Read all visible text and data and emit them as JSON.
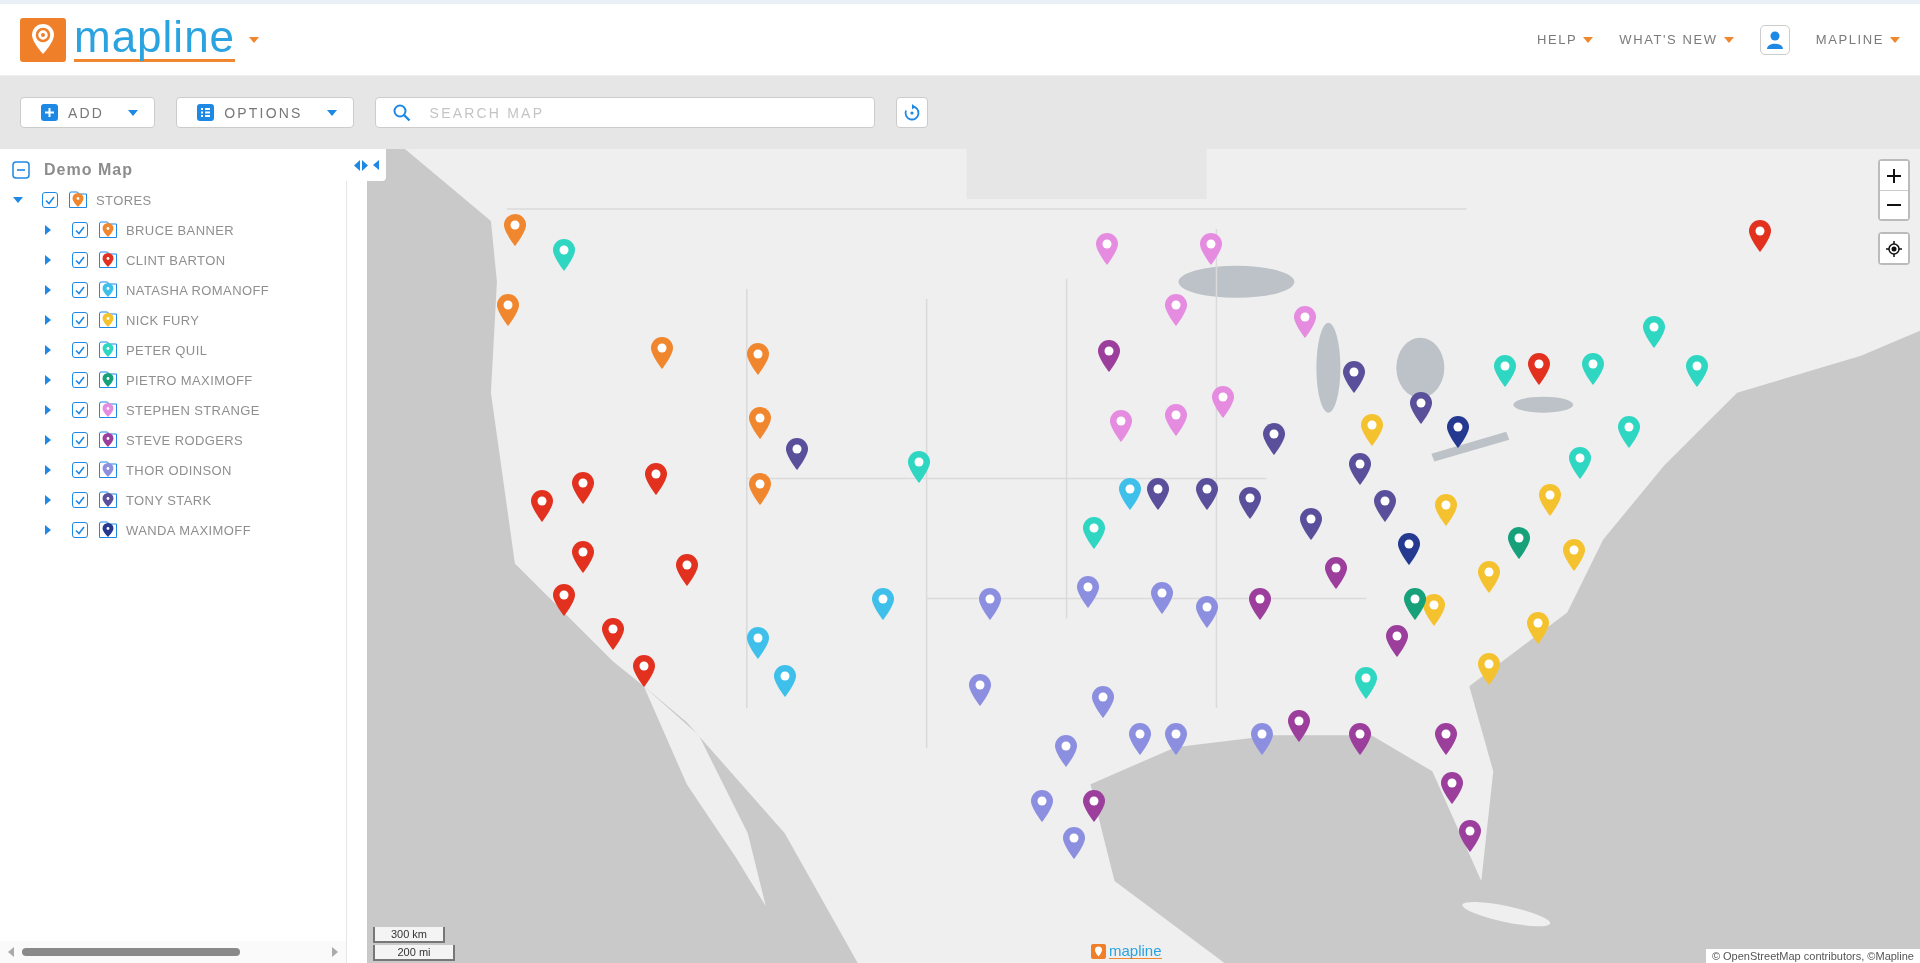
{
  "header": {
    "logo_text": "mapline",
    "menu": [
      {
        "label": "HELP",
        "kind": "menu"
      },
      {
        "label": "WHAT'S NEW",
        "kind": "menu"
      },
      {
        "label": "MAPLINE",
        "kind": "account"
      }
    ]
  },
  "toolbar": {
    "buttons": [
      {
        "label": "ADD",
        "kind": "add"
      },
      {
        "label": "OPTIONS",
        "kind": "options"
      }
    ],
    "search": {
      "placeholder": "SEARCH MAP"
    }
  },
  "sidebar": {
    "map": {
      "label": "Demo Map",
      "expanded": true
    },
    "layers": [
      {
        "label": "STORES",
        "expanded": true,
        "checked": true,
        "color": "#f0862e",
        "children": [
          {
            "label": "BRUCE BANNER",
            "expanded": false,
            "checked": true,
            "color": "#f0862e"
          },
          {
            "label": "CLINT BARTON",
            "expanded": false,
            "checked": true,
            "color": "#e2321f"
          },
          {
            "label": "NATASHA ROMANOFF",
            "expanded": false,
            "checked": true,
            "color": "#3fc0ea"
          },
          {
            "label": "NICK FURY",
            "expanded": false,
            "checked": true,
            "color": "#f5c22f"
          },
          {
            "label": "PETER QUIL",
            "expanded": false,
            "checked": true,
            "color": "#2fd6c2"
          },
          {
            "label": "PIETRO MAXIMOFF",
            "expanded": false,
            "checked": true,
            "color": "#17a17a"
          },
          {
            "label": "STEPHEN STRANGE",
            "expanded": false,
            "checked": true,
            "color": "#e58be0"
          },
          {
            "label": "STEVE RODGERS",
            "expanded": false,
            "checked": true,
            "color": "#9c3e9c"
          },
          {
            "label": "THOR ODINSON",
            "expanded": false,
            "checked": true,
            "color": "#8c8fe0"
          },
          {
            "label": "TONY STARK",
            "expanded": false,
            "checked": true,
            "color": "#5a4f9b"
          },
          {
            "label": "WANDA MAXIMOFF",
            "expanded": false,
            "checked": true,
            "color": "#24398f"
          }
        ]
      }
    ]
  },
  "map": {
    "scale": [
      "300 km",
      "200 mi"
    ],
    "logo_text": "mapline",
    "attribution": "© OpenStreetMap contributors, ©Mapline"
  }
}
